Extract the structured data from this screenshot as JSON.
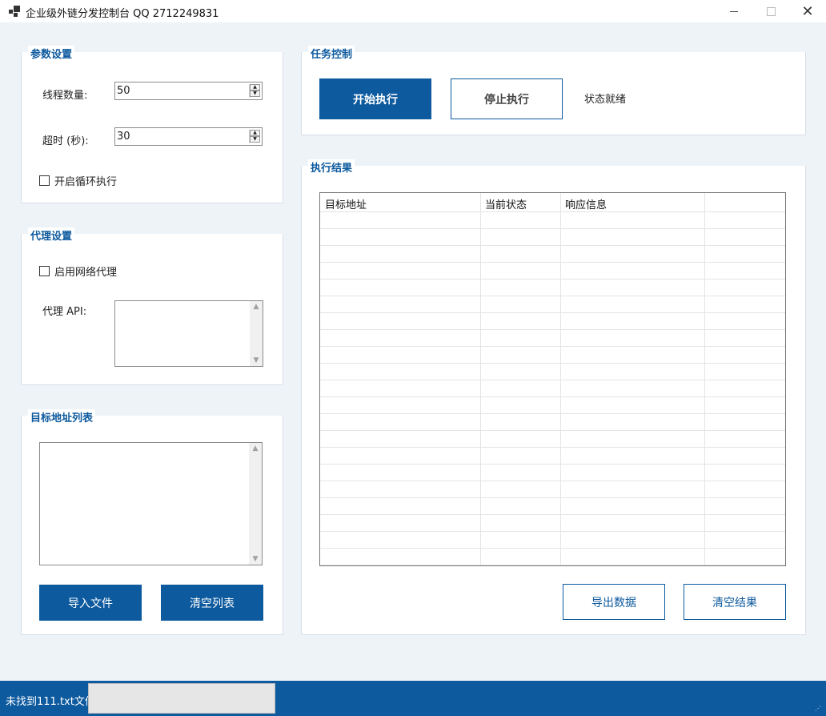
{
  "window": {
    "title": "企业级外链分发控制台 QQ 2712249831",
    "minimize": "—",
    "close": "✕"
  },
  "params": {
    "title": "参数设置",
    "threads_label": "线程数量:",
    "threads_value": "50",
    "timeout_label": "超时 (秒):",
    "timeout_value": "30",
    "loop_label": "开启循环执行"
  },
  "proxy": {
    "title": "代理设置",
    "enable_label": "启用网络代理",
    "api_label": "代理 API:"
  },
  "targets": {
    "title": "目标地址列表",
    "import_label": "导入文件",
    "clear_label": "清空列表"
  },
  "task": {
    "title": "任务控制",
    "start_label": "开始执行",
    "stop_label": "停止执行",
    "status_text": "状态就绪"
  },
  "results": {
    "title": "执行结果",
    "columns": [
      "目标地址",
      "当前状态",
      "响应信息"
    ],
    "export_label": "导出数据",
    "clear_label": "清空结果"
  },
  "statusbar": {
    "message": "未找到111.txt文件"
  },
  "colors": {
    "accent": "#0d5a9e",
    "background": "#eef3f8"
  }
}
